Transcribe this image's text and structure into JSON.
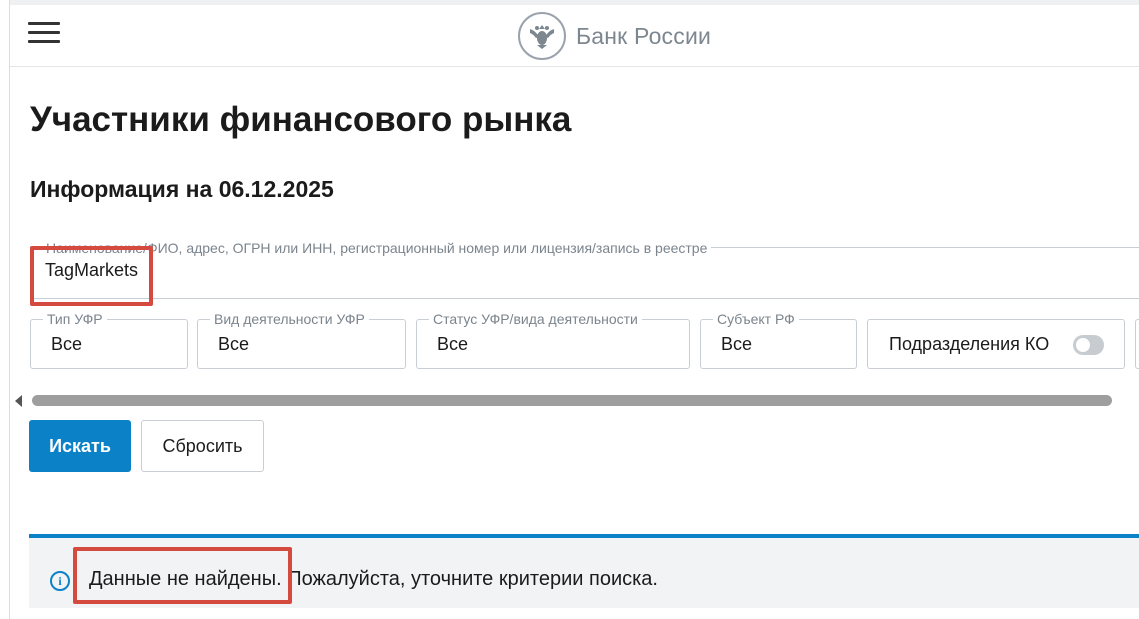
{
  "header": {
    "brand_name": "Банк России"
  },
  "page": {
    "title": "Участники финансового рынка",
    "info_date": "Информация на 06.12.2025"
  },
  "search": {
    "label": "Наименование/ФИО, адрес, ОГРН или ИНН, регистрационный номер или лицензия/запись в реестре",
    "value": "TagMarkets"
  },
  "filters": [
    {
      "label": "Тип УФР",
      "value": "Все"
    },
    {
      "label": "Вид деятельности УФР",
      "value": "Все"
    },
    {
      "label": "Статус УФР/вида деятельности",
      "value": "Все"
    },
    {
      "label": "Субъект РФ",
      "value": "Все"
    }
  ],
  "toggle": {
    "label": "Подразделения КО",
    "enabled": false
  },
  "actions": {
    "search_label": "Искать",
    "reset_label": "Сбросить"
  },
  "result": {
    "message": "Данные не найдены. Пожалуйста, уточните критерии поиска."
  },
  "colors": {
    "accent": "#0b82c8",
    "highlight": "#d44a3f"
  }
}
